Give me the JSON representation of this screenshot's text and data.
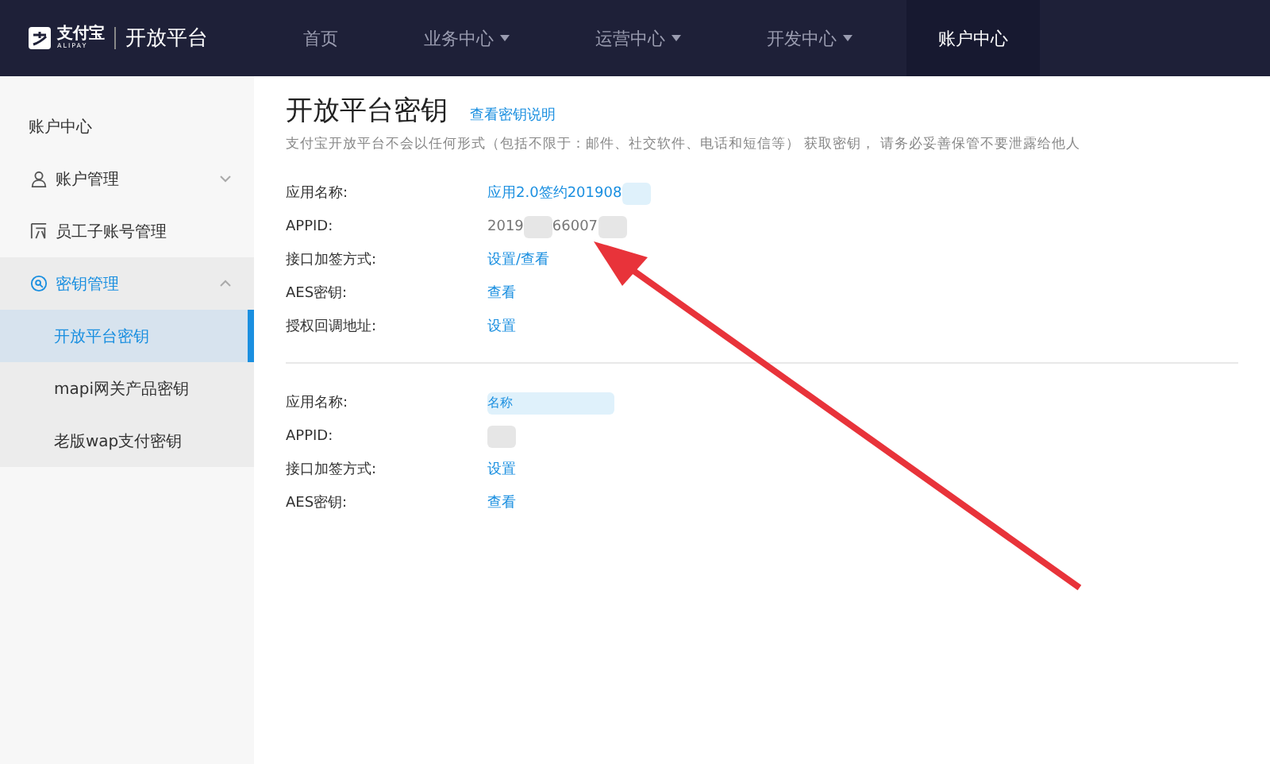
{
  "brand": {
    "logo": "支付宝",
    "logo_sub": "ALIPAY",
    "name": "开放平台"
  },
  "nav": [
    {
      "label": "首页",
      "dropdown": false,
      "selected": false
    },
    {
      "label": "业务中心",
      "dropdown": true,
      "selected": false
    },
    {
      "label": "运营中心",
      "dropdown": true,
      "selected": false
    },
    {
      "label": "开发中心",
      "dropdown": true,
      "selected": false
    },
    {
      "label": "账户中心",
      "dropdown": false,
      "selected": true
    }
  ],
  "sidebar": {
    "title": "账户中心",
    "items": [
      {
        "label": "账户管理",
        "expanded": false,
        "has_toggle": true
      },
      {
        "label": "员工子账号管理",
        "expanded": false,
        "has_toggle": false
      },
      {
        "label": "密钥管理",
        "expanded": true,
        "has_toggle": true,
        "children": [
          {
            "label": "开放平台密钥",
            "selected": true
          },
          {
            "label": "mapi网关产品密钥",
            "selected": false
          },
          {
            "label": "老版wap支付密钥",
            "selected": false
          }
        ]
      }
    ]
  },
  "page": {
    "title": "开放平台密钥",
    "help_link": "查看密钥说明",
    "notice": "支付宝开放平台不会以任何形式（包括不限于：邮件、社交软件、电话和短信等） 获取密钥， 请务必妥善保管不要泄露给他人"
  },
  "apps": [
    {
      "fields": [
        {
          "label": "应用名称:",
          "kind": "link",
          "parts": [
            {
              "text": "应用2.0签约201908",
              "redacted": false
            },
            {
              "redacted": true
            }
          ]
        },
        {
          "label": "APPID:",
          "kind": "text",
          "parts": [
            {
              "text": "2019",
              "redacted": false
            },
            {
              "redacted": true
            },
            {
              "text": "66007",
              "redacted": false
            },
            {
              "redacted": true
            }
          ]
        },
        {
          "label": "接口加签方式:",
          "kind": "link",
          "parts": [
            {
              "text": "设置/查看",
              "redacted": false
            }
          ]
        },
        {
          "label": "AES密钥:",
          "kind": "link",
          "parts": [
            {
              "text": "查看",
              "redacted": false
            }
          ]
        },
        {
          "label": "授权回调地址:",
          "kind": "link",
          "parts": [
            {
              "text": "设置",
              "redacted": false
            }
          ]
        }
      ]
    },
    {
      "fields": [
        {
          "label": "应用名称:",
          "kind": "link",
          "parts": [
            {
              "text": "名称",
              "redacted": true
            }
          ]
        },
        {
          "label": "APPID:",
          "kind": "text",
          "parts": [
            {
              "redacted": true
            }
          ]
        },
        {
          "label": "接口加签方式:",
          "kind": "link",
          "parts": [
            {
              "text": "设置",
              "redacted": false
            }
          ]
        },
        {
          "label": "AES密钥:",
          "kind": "link",
          "parts": [
            {
              "text": "查看",
              "redacted": false
            }
          ]
        }
      ]
    }
  ]
}
